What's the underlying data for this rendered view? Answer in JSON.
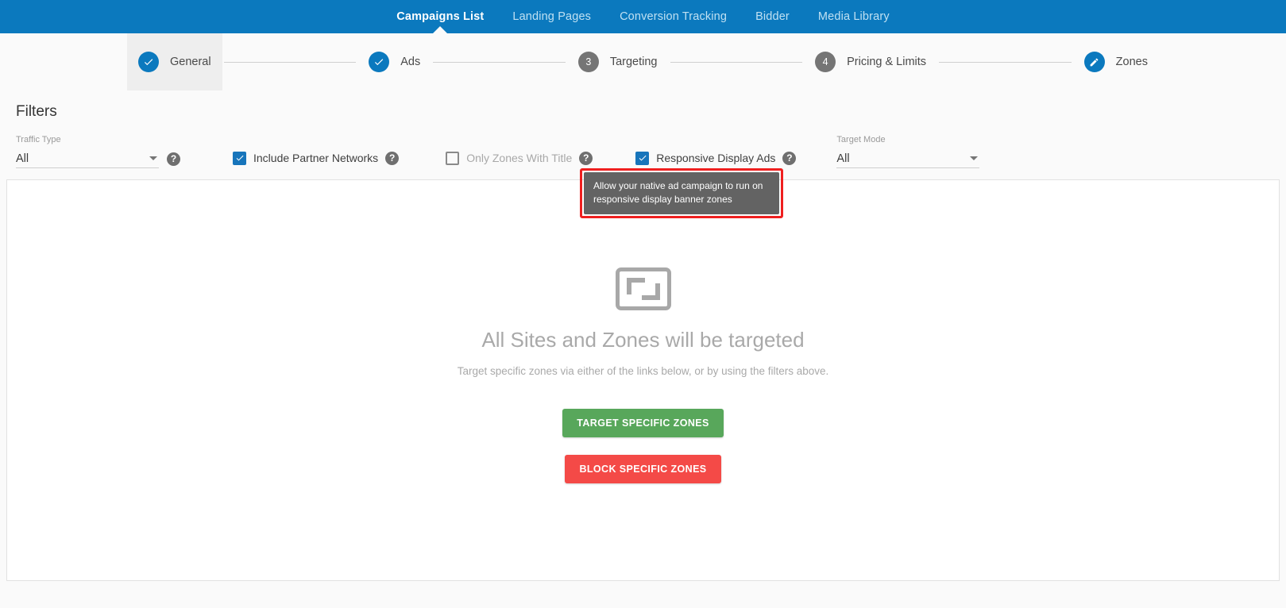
{
  "nav": {
    "items": [
      {
        "label": "Campaigns List",
        "active": true
      },
      {
        "label": "Landing Pages",
        "active": false
      },
      {
        "label": "Conversion Tracking",
        "active": false
      },
      {
        "label": "Bidder",
        "active": false
      },
      {
        "label": "Media Library",
        "active": false
      }
    ],
    "background_color": "#0b79be"
  },
  "stepper": {
    "steps": [
      {
        "label": "General",
        "badge": "check",
        "badge_text": "",
        "state": "completed",
        "current_highlight": true
      },
      {
        "label": "Ads",
        "badge": "check",
        "badge_text": "",
        "state": "completed",
        "current_highlight": false
      },
      {
        "label": "Targeting",
        "badge": "number",
        "badge_text": "3",
        "state": "pending",
        "current_highlight": false
      },
      {
        "label": "Pricing & Limits",
        "badge": "number",
        "badge_text": "4",
        "state": "pending",
        "current_highlight": false
      },
      {
        "label": "Zones",
        "badge": "pencil",
        "badge_text": "",
        "state": "active",
        "current_highlight": false
      }
    ],
    "active_color": "#0b79be",
    "pending_color": "#757575"
  },
  "filters": {
    "title": "Filters",
    "traffic_type": {
      "label": "Traffic Type",
      "value": "All",
      "help_icon": "question-mark-icon"
    },
    "target_mode": {
      "label": "Target Mode",
      "value": "All"
    },
    "checkboxes": [
      {
        "label": "Include Partner Networks",
        "checked": true,
        "disabled": false,
        "help_icon": "question-mark-icon"
      },
      {
        "label": "Only Zones With Title",
        "checked": false,
        "disabled": true,
        "help_icon": "question-mark-icon"
      },
      {
        "label": "Responsive Display Ads",
        "checked": true,
        "disabled": false,
        "help_icon": "question-mark-icon"
      }
    ],
    "help_glyph": "?"
  },
  "tooltip": {
    "text": "Allow your native ad campaign to run on responsive display banner zones",
    "background_color": "#636363",
    "highlight_border_color": "#ef1f1f"
  },
  "empty_state": {
    "icon": "fit-screen-icon",
    "title": "All Sites and Zones will be targeted",
    "subtitle": "Target specific zones via either of the links below, or by using the filters above.",
    "primary_button": {
      "label": "TARGET SPECIFIC ZONES",
      "color": "#58a75b"
    },
    "secondary_button": {
      "label": "BLOCK SPECIFIC ZONES",
      "color": "#f44a47"
    }
  }
}
